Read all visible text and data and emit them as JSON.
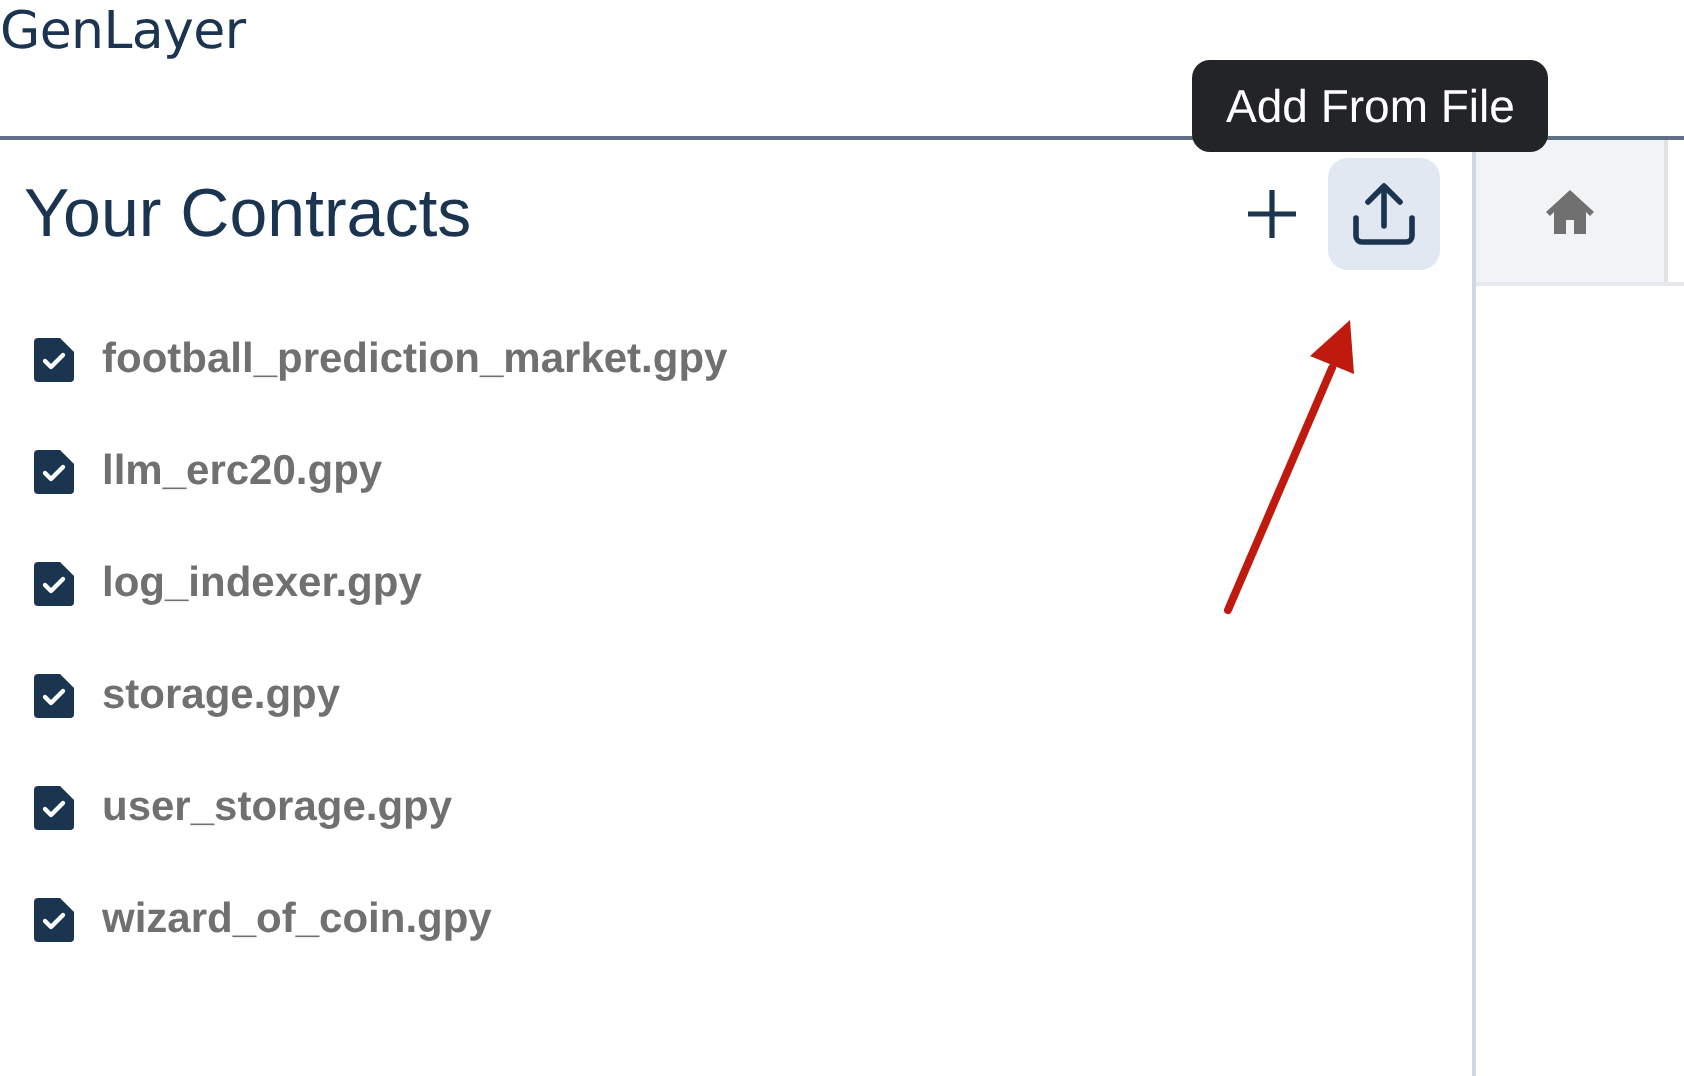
{
  "logo": "GenLayer",
  "contracts_panel": {
    "title": "Your Contracts",
    "tooltip": "Add From File",
    "files": [
      {
        "name": "football_prediction_market.gpy"
      },
      {
        "name": "llm_erc20.gpy"
      },
      {
        "name": "log_indexer.gpy"
      },
      {
        "name": "storage.gpy"
      },
      {
        "name": "user_storage.gpy"
      },
      {
        "name": "wizard_of_coin.gpy"
      }
    ]
  },
  "tabs": [
    {
      "kind": "home",
      "selected": false
    }
  ]
}
